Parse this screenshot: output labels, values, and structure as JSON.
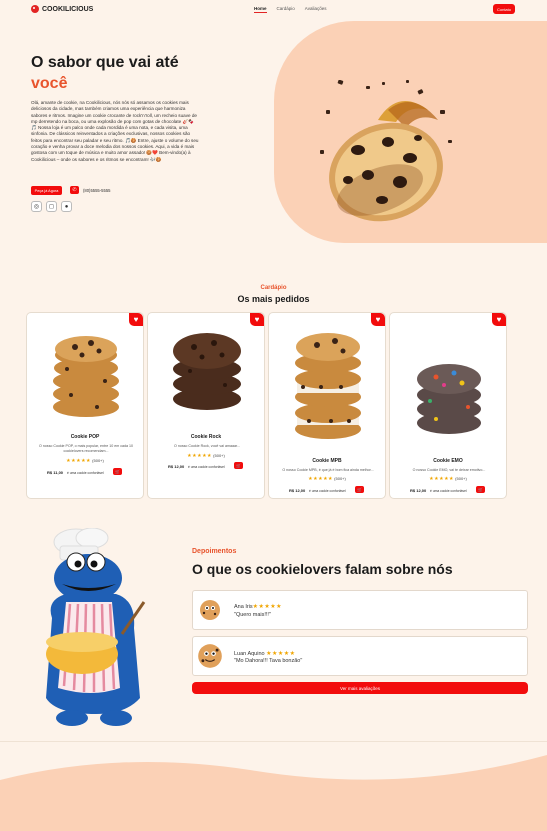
{
  "nav": {
    "brand": "COOKILICIOUS",
    "links": [
      "Home",
      "Cardápio",
      "Avaliações"
    ],
    "cta": "Contato"
  },
  "hero": {
    "title_line1": "O sabor que vai até",
    "title_line2": "você",
    "text": "Olá, amante de cookie, na Cookilicious, nós nós só assamos os cookies mais deliciosos da cidade, mas também criamos uma experiência que harmoniza sabores e ritmos. Imagine um cookie crocante de rock'n'roll, um recheio suave de mp derretendo na boca, ou uma explosão de pop com gotas de chocolate 🎸🍫🎵 Nossa loja é um palco onde cada mordida é uma nota, e cada visita, uma sinfonia. De clássicos reinventados a criações exclusivas, nossos cookies são feitos para encontrar seu paladar e seu ritmo. 🎵🍪 Entre, ajuste o volume do seu coração e venha provar a doce melodia dos nossos cookies. Aqui, a vida é mais gostosa com um toque de música e muito amor assado! 🍪❤️ Bem-vindo(a) à Cookilicious – onde os sabores e os ritmos se encontram! 🎶🍪",
    "order_button": "Peça já Agora",
    "phone": "(80)5555-5555"
  },
  "menu": {
    "kicker": "Cardápio",
    "title": "Os mais pedidos",
    "cards": [
      {
        "name": "Cookie POP",
        "desc": "O nosso Cookie POP, o mais popular, entre 10 em cada 10 cookielovers recomendam...",
        "rating": "(500+)",
        "price": "R$ 11,00",
        "sub": "é uma cookie confortável"
      },
      {
        "name": "Cookie Rock",
        "desc": "O nosso Cookie Rock, você vai amaaar...",
        "rating": "(500+)",
        "price": "R$ 12,00",
        "sub": "é uma cookie confortável"
      },
      {
        "name": "Cookie MPB",
        "desc": "O nosso Cookie MPB, é que já é bom fica ainda melhor...",
        "rating": "(500+)",
        "price": "R$ 12,00",
        "sub": "é uma cookie confortável"
      },
      {
        "name": "Cookie EMO",
        "desc": "O nosso Cookie EMO, vai te deixar emotivo...",
        "rating": "(500+)",
        "price": "R$ 12,00",
        "sub": "é uma cookie confortável"
      }
    ]
  },
  "testimonials": {
    "kicker": "Depoimentos",
    "title": "O que os cookielovers falam sobre nós",
    "items": [
      {
        "name": "Ana Iris",
        "quote": "\"Quero mais!!!\""
      },
      {
        "name": "Luan Aquino",
        "quote": "\"Mo Dahora!!! Tava bonzão\""
      }
    ],
    "more_button": "Ver mais avaliações"
  },
  "colors": {
    "accent": "#f20c0c",
    "orange": "#e8542d",
    "peach": "#fbd1b6",
    "background": "#fdf3ea"
  }
}
